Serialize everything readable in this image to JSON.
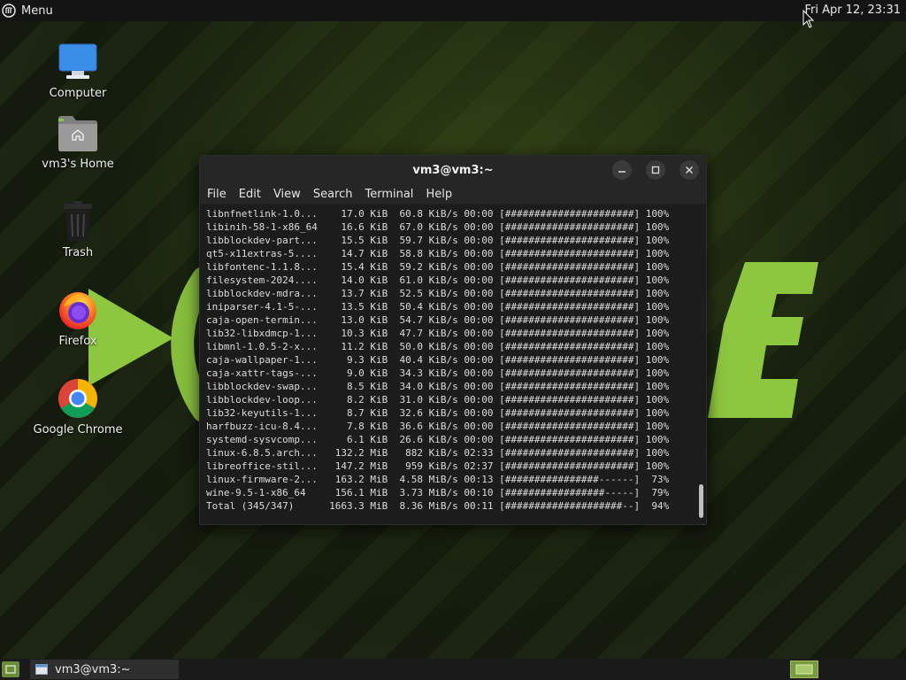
{
  "top_panel": {
    "menu_label": "Menu",
    "menu_icon": "mint-menu-icon",
    "clock": "Fri Apr 12, 23:31"
  },
  "desktop_icons": [
    {
      "label": "Computer",
      "icon": "computer-icon"
    },
    {
      "label": "vm3's Home",
      "icon": "home-folder-icon"
    },
    {
      "label": "Trash",
      "icon": "trash-icon"
    },
    {
      "label": "Firefox",
      "icon": "firefox-icon"
    },
    {
      "label": "Google Chrome",
      "icon": "chrome-icon"
    }
  ],
  "terminal": {
    "title": "vm3@vm3:~",
    "menu": [
      "File",
      "Edit",
      "View",
      "Search",
      "Terminal",
      "Help"
    ],
    "lines": [
      "libnfnetlink-1.0...    17.0 KiB  60.8 KiB/s 00:00 [######################] 100%",
      "libinih-58-1-x86_64    16.6 KiB  67.0 KiB/s 00:00 [######################] 100%",
      "libblockdev-part...    15.5 KiB  59.7 KiB/s 00:00 [######################] 100%",
      "qt5-x11extras-5....    14.7 KiB  58.8 KiB/s 00:00 [######################] 100%",
      "libfontenc-1.1.8...    15.4 KiB  59.2 KiB/s 00:00 [######################] 100%",
      "filesystem-2024....    14.0 KiB  61.0 KiB/s 00:00 [######################] 100%",
      "libblockdev-mdra...    13.7 KiB  52.5 KiB/s 00:00 [######################] 100%",
      "iniparser-4.1-5-...    13.5 KiB  50.4 KiB/s 00:00 [######################] 100%",
      "caja-open-termin...    13.0 KiB  54.7 KiB/s 00:00 [######################] 100%",
      "lib32-libxdmcp-1...    10.3 KiB  47.7 KiB/s 00:00 [######################] 100%",
      "libmnl-1.0.5-2-x...    11.2 KiB  50.0 KiB/s 00:00 [######################] 100%",
      "caja-wallpaper-1...     9.3 KiB  40.4 KiB/s 00:00 [######################] 100%",
      "caja-xattr-tags-...     9.0 KiB  34.3 KiB/s 00:00 [######################] 100%",
      "libblockdev-swap...     8.5 KiB  34.0 KiB/s 00:00 [######################] 100%",
      "libblockdev-loop...     8.2 KiB  31.0 KiB/s 00:00 [######################] 100%",
      "lib32-keyutils-1...     8.7 KiB  32.6 KiB/s 00:00 [######################] 100%",
      "harfbuzz-icu-8.4...     7.8 KiB  36.6 KiB/s 00:00 [######################] 100%",
      "systemd-sysvcomp...     6.1 KiB  26.6 KiB/s 00:00 [######################] 100%",
      "linux-6.8.5.arch...   132.2 MiB   882 KiB/s 02:33 [######################] 100%",
      "libreoffice-stil...   147.2 MiB   959 KiB/s 02:37 [######################] 100%",
      "linux-firmware-2...   163.2 MiB  4.58 MiB/s 00:13 [################------]  73%",
      "wine-9.5-1-x86_64     156.1 MiB  3.73 MiB/s 00:10 [#################-----]  79%",
      "Total (345/347)      1663.3 MiB  8.36 MiB/s 00:11 [####################--]  94%"
    ]
  },
  "taskbar": {
    "window_label": "vm3@vm3:~"
  },
  "colors": {
    "accent_green": "#8dc63f"
  }
}
